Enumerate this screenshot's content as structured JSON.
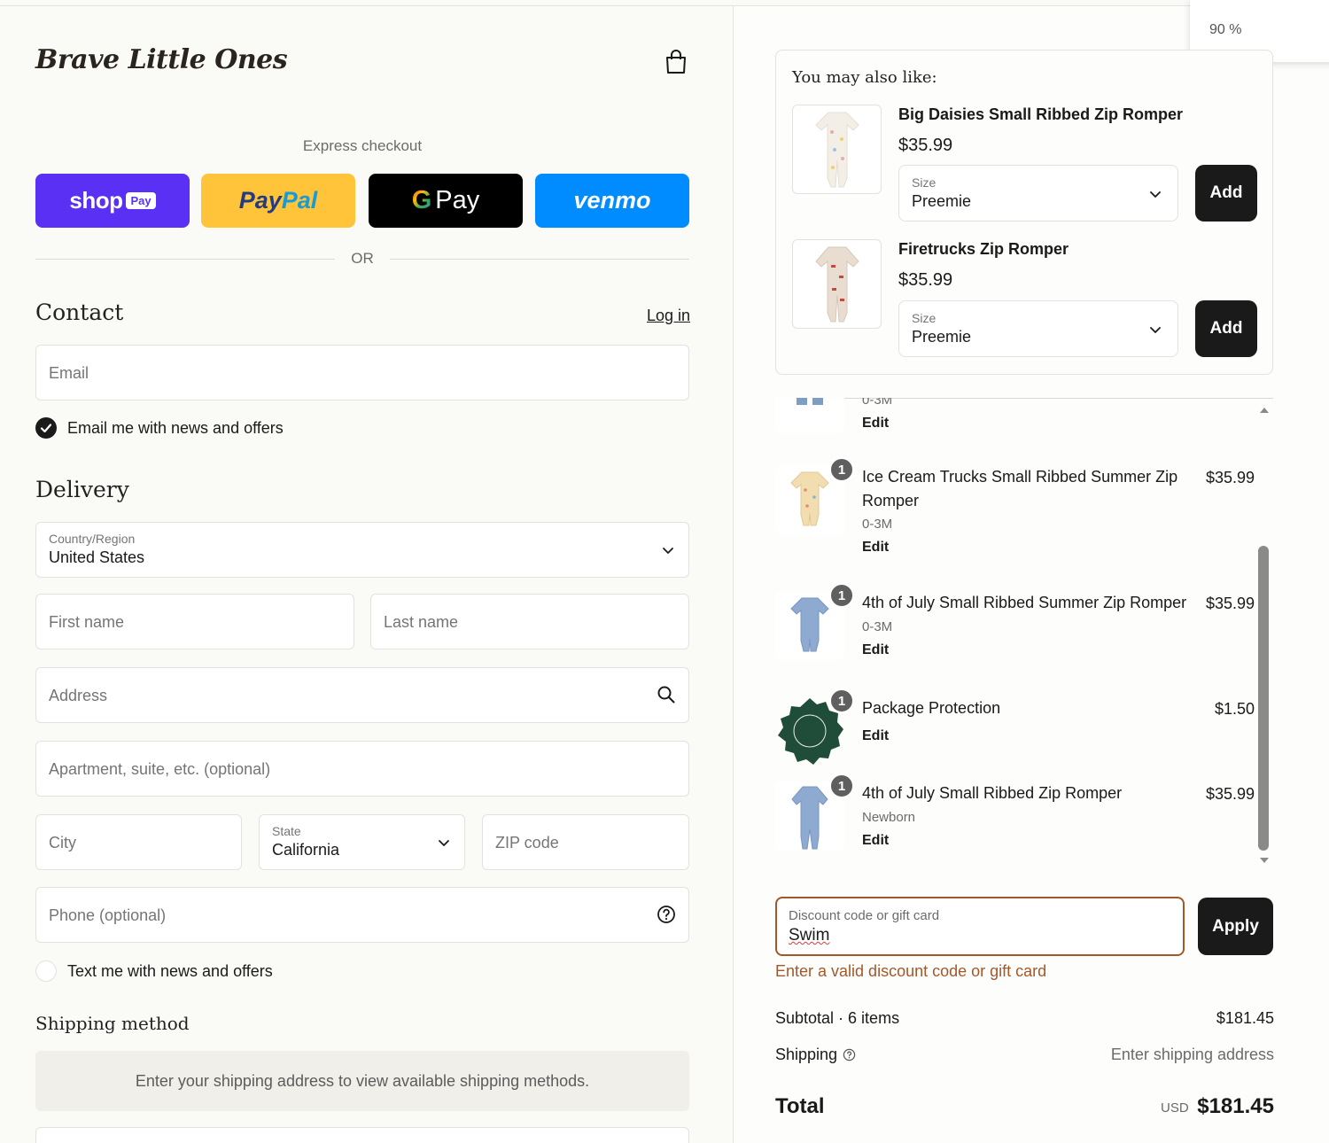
{
  "brand": "Brave Little Ones",
  "zoom": "90 %",
  "express": {
    "label": "Express checkout",
    "shop_pay": {
      "word": "shop",
      "tag": "Pay"
    },
    "paypal": {
      "part1": "Pay",
      "part2": "Pal"
    },
    "gpay": {
      "g": "G",
      "word": "Pay"
    },
    "venmo": "venmo",
    "or": "OR"
  },
  "contact": {
    "heading": "Contact",
    "login": "Log in",
    "email_placeholder": "Email",
    "news_checkbox": "Email me with news and offers"
  },
  "delivery": {
    "heading": "Delivery",
    "country": {
      "label": "Country/Region",
      "value": "United States"
    },
    "first_name": "First name",
    "last_name": "Last name",
    "address": "Address",
    "apartment": "Apartment, suite, etc. (optional)",
    "city": "City",
    "state": {
      "label": "State",
      "value": "California"
    },
    "zip": "ZIP code",
    "phone": "Phone (optional)",
    "text_checkbox": "Text me with news and offers"
  },
  "shipping": {
    "heading": "Shipping method",
    "message": "Enter your shipping address to view available shipping methods."
  },
  "upsell": {
    "title": "You may also like:",
    "items": [
      {
        "name": "Big Daisies Small Ribbed Zip Romper",
        "price": "$35.99",
        "size_label": "Size",
        "size_value": "Preemie",
        "add": "Add"
      },
      {
        "name": "Firetrucks Zip Romper",
        "price": "$35.99",
        "size_label": "Size",
        "size_value": "Preemie",
        "add": "Add"
      }
    ]
  },
  "cart": {
    "partial_item": {
      "variant": "0-3M",
      "edit": "Edit"
    },
    "items": [
      {
        "qty": "1",
        "name": "Ice Cream Trucks Small Ribbed Summer Zip Romper",
        "variant": "0-3M",
        "edit": "Edit",
        "price": "$35.99"
      },
      {
        "qty": "1",
        "name": "4th of July Small Ribbed Summer Zip Romper",
        "variant": "0-3M",
        "edit": "Edit",
        "price": "$35.99"
      },
      {
        "qty": "1",
        "name": "Package Protection",
        "variant": "",
        "edit": "Edit",
        "price": "$1.50"
      },
      {
        "qty": "1",
        "name": "4th of July Small Ribbed Zip Romper",
        "variant": "Newborn",
        "edit": "Edit",
        "price": "$35.99"
      }
    ]
  },
  "discount": {
    "label": "Discount code or gift card",
    "value": "Swim",
    "apply": "Apply",
    "error": "Enter a valid discount code or gift card"
  },
  "summary": {
    "subtotal_label": "Subtotal · 6 items",
    "subtotal_value": "$181.45",
    "shipping_label": "Shipping",
    "shipping_value": "Enter shipping address",
    "total_label": "Total",
    "currency": "USD",
    "total_value": "$181.45"
  },
  "colors": {
    "shop_pay": "#5a31f4",
    "paypal": "#ffc439",
    "venmo": "#008cff",
    "error": "#a3582a"
  }
}
